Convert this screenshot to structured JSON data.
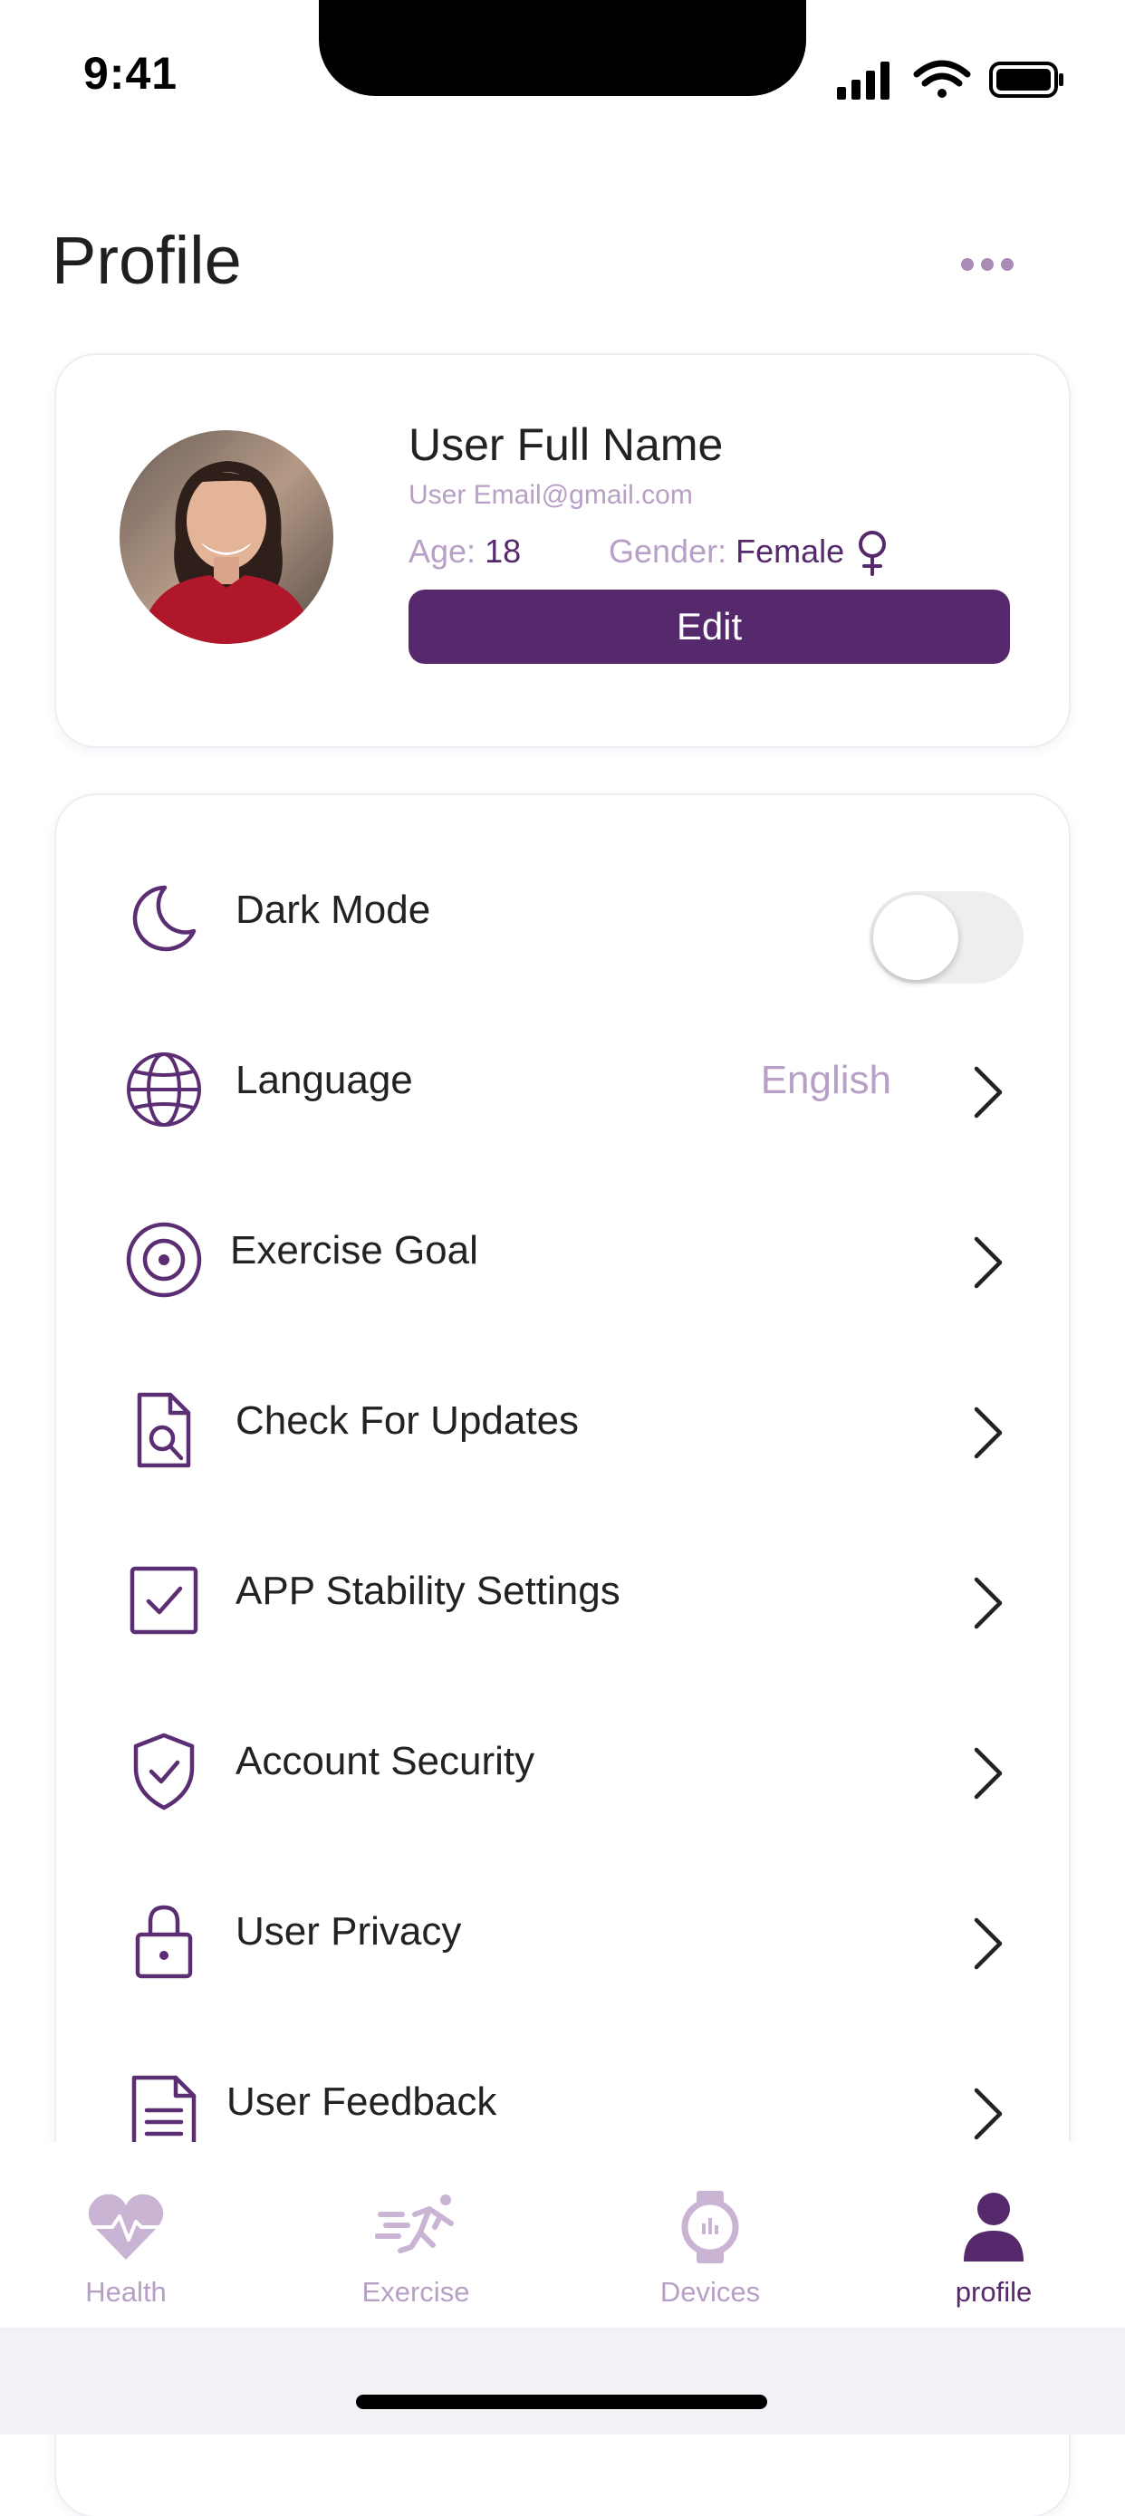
{
  "status_bar": {
    "time": "9:41"
  },
  "header": {
    "title": "Profile"
  },
  "profile": {
    "name": "User Full Name",
    "email": "User Email@gmail.com",
    "age_label": "Age: ",
    "age_value": "18",
    "gender_label": "Gender: ",
    "gender_value": "Female",
    "edit_label": "Edit"
  },
  "settings": {
    "dark_mode": {
      "label": "Dark Mode",
      "enabled": false
    },
    "items": [
      {
        "label": "Language",
        "value": "English",
        "icon": "globe-icon"
      },
      {
        "label": "Exercise Goal",
        "icon": "target-icon"
      },
      {
        "label": "Check For Updates",
        "icon": "document-search-icon"
      },
      {
        "label": "APP Stability Settings",
        "icon": "checkbox-icon"
      },
      {
        "label": "Account Security",
        "icon": "shield-check-icon"
      },
      {
        "label": "User Privacy",
        "icon": "lock-icon"
      },
      {
        "label": "User Feedback",
        "icon": "document-lines-icon"
      }
    ]
  },
  "tabbar": {
    "tabs": [
      {
        "label": "Health",
        "icon": "heart-pulse-icon",
        "active": false
      },
      {
        "label": "Exercise",
        "icon": "runner-icon",
        "active": false
      },
      {
        "label": "Devices",
        "icon": "watch-icon",
        "active": false
      },
      {
        "label": "profile",
        "icon": "person-icon",
        "active": true
      }
    ]
  },
  "colors": {
    "primary": "#55296b",
    "accent_light": "#b79fc6",
    "icon": "#5b2d72"
  }
}
